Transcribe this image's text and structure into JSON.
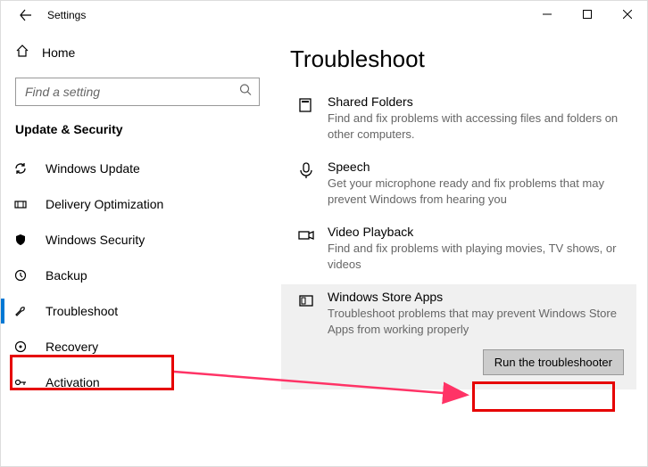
{
  "window": {
    "title": "Settings"
  },
  "sidebar": {
    "home_label": "Home",
    "search_placeholder": "Find a setting",
    "category": "Update & Security",
    "items": [
      {
        "label": "Windows Update"
      },
      {
        "label": "Delivery Optimization"
      },
      {
        "label": "Windows Security"
      },
      {
        "label": "Backup"
      },
      {
        "label": "Troubleshoot"
      },
      {
        "label": "Recovery"
      },
      {
        "label": "Activation"
      }
    ]
  },
  "main": {
    "header": "Troubleshoot",
    "entries": [
      {
        "title": "Shared Folders",
        "desc": "Find and fix problems with accessing files and folders on other computers."
      },
      {
        "title": "Speech",
        "desc": "Get your microphone ready and fix problems that may prevent Windows from hearing you"
      },
      {
        "title": "Video Playback",
        "desc": "Find and fix problems with playing movies, TV shows, or videos"
      },
      {
        "title": "Windows Store Apps",
        "desc": "Troubleshoot problems that may prevent Windows Store Apps from working properly"
      }
    ],
    "run_button": "Run the troubleshooter"
  }
}
